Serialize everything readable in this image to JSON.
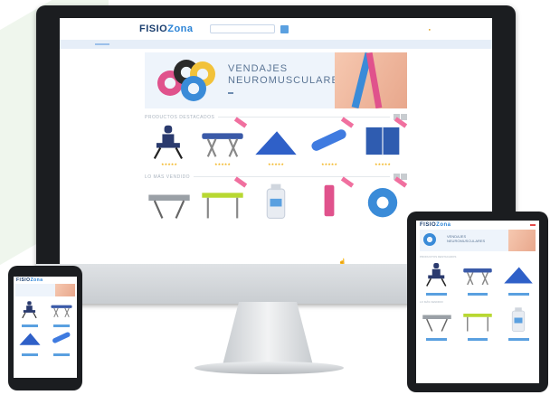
{
  "site": {
    "logo_main": "FISIO",
    "logo_sub": "Zona",
    "search_placeholder": "",
    "phone": "",
    "email": "",
    "cart": ""
  },
  "nav": {
    "items": [
      "",
      "",
      "",
      "",
      "",
      ""
    ]
  },
  "banner": {
    "line1": "VENDAJES",
    "line2": "NEUROMUSCULARES",
    "more": ""
  },
  "sections": {
    "featured": "PRODUCTOS DESTACADOS",
    "bestsellers": "LO MÁS VENDIDO"
  },
  "products": [
    {
      "name": "",
      "price": "",
      "img": "massage-chair",
      "color": "#2a3a6e"
    },
    {
      "name": "",
      "price": "",
      "img": "massage-table",
      "color": "#3a5aa8"
    },
    {
      "name": "",
      "price": "",
      "img": "wedge-cushion",
      "color": "#2f60c8"
    },
    {
      "name": "",
      "price": "",
      "img": "roll-cushion",
      "color": "#3f7be0"
    },
    {
      "name": "",
      "price": "",
      "img": "folding-panel",
      "color": "#2f5cb0"
    }
  ],
  "bestsellers": [
    {
      "img": "folding-table-gray",
      "color": "#9aa0a6"
    },
    {
      "img": "table-lime",
      "color": "#b8d832"
    },
    {
      "img": "gel-bottle",
      "color": "#e8ecf2"
    },
    {
      "img": "pink-product",
      "color": "#e0528c"
    },
    {
      "img": "blue-tape",
      "color": "#3a8bd8"
    }
  ],
  "colors": {
    "accent": "#2a83d6",
    "nav_bg": "#e6eef8",
    "tag": "#f0709f"
  }
}
